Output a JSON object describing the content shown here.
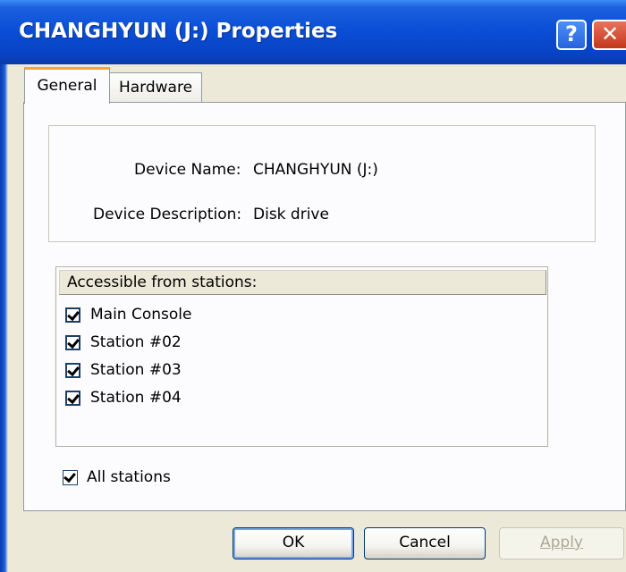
{
  "window": {
    "title": "CHANGHYUN (J:) Properties",
    "help_symbol": "?",
    "close_symbol": "✕"
  },
  "tabs": [
    {
      "label": "General",
      "selected": true
    },
    {
      "label": "Hardware",
      "selected": false
    }
  ],
  "device": {
    "name_label": "Device Name:",
    "name_value": "CHANGHYUN (J:)",
    "desc_label": "Device Description:",
    "desc_value": "Disk drive"
  },
  "stations": {
    "header": "Accessible from stations:",
    "items": [
      {
        "label": "Main Console",
        "checked": true
      },
      {
        "label": "Station #02",
        "checked": true
      },
      {
        "label": "Station #03",
        "checked": true
      },
      {
        "label": "Station #04",
        "checked": true
      }
    ],
    "all_label": "All stations",
    "all_checked": true
  },
  "buttons": {
    "ok": "OK",
    "cancel": "Cancel",
    "apply": "Apply"
  },
  "colors": {
    "titlebar": "#0a4fd6",
    "dialog_bg": "#ece9d8",
    "tab_accent": "#f5a732"
  }
}
